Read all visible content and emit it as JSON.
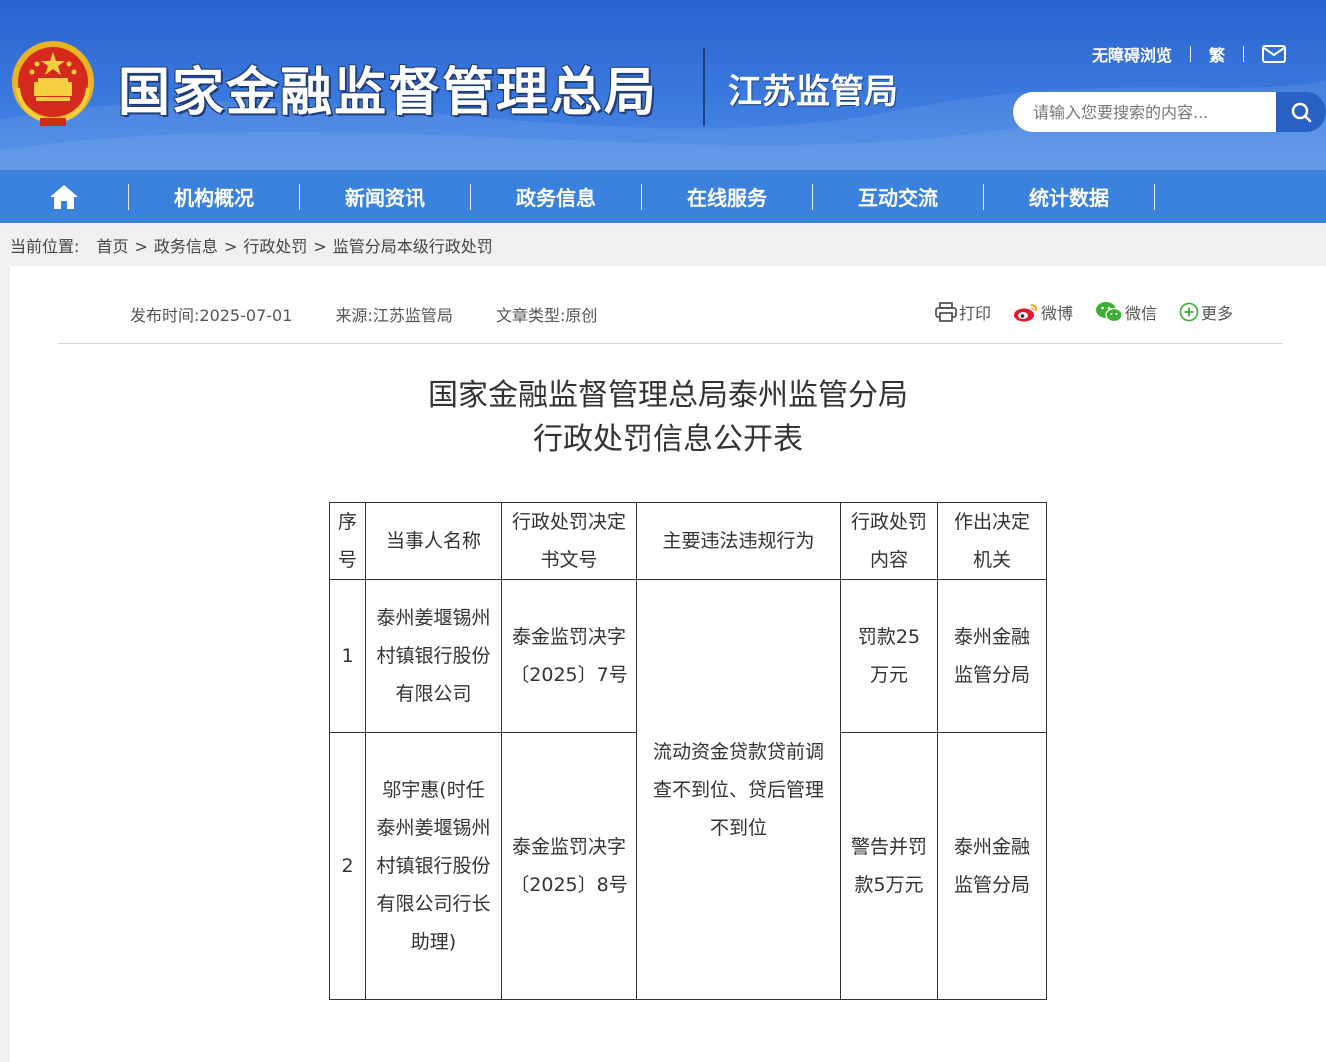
{
  "header": {
    "site_title": "国家金融监督管理总局",
    "sub_title": "江苏监管局",
    "accessibility_link": "无障碍浏览",
    "traditional_link": "繁",
    "search_placeholder": "请输入您要搜索的内容..."
  },
  "nav": {
    "items": [
      "机构概况",
      "新闻资讯",
      "政务信息",
      "在线服务",
      "互动交流",
      "统计数据"
    ]
  },
  "breadcrumb": {
    "prefix": "当前位置:",
    "items": [
      "首页",
      "政务信息",
      "行政处罚",
      "监管分局本级行政处罚"
    ]
  },
  "article": {
    "publish_time": "发布时间:2025-07-01",
    "source": "来源:江苏监管局",
    "type": "文章类型:原创",
    "share": {
      "print": "打印",
      "weibo": "微博",
      "wechat": "微信",
      "more": "更多"
    },
    "title_line1": "国家金融监督管理总局泰州监管分局",
    "title_line2": "行政处罚信息公开表"
  },
  "table": {
    "headers": [
      "序号",
      "当事人名称",
      "行政处罚决定书文号",
      "主要违法违规行为",
      "行政处罚内容",
      "作出决定机关"
    ],
    "rows": [
      {
        "no": "1",
        "party": "泰州姜堰锡州村镇银行股份有限公司",
        "doc_no": "泰金监罚决字〔2025〕7号",
        "penalty": "罚款25万元",
        "authority": "泰州金融监管分局"
      },
      {
        "no": "2",
        "party": "邬宇惠(时任泰州姜堰锡州村镇银行股份有限公司行长助理)",
        "doc_no": "泰金监罚决字〔2025〕8号",
        "penalty": "警告并罚款5万元",
        "authority": "泰州金融监管分局"
      }
    ],
    "violation": "流动资金贷款贷前调查不到位、贷后管理不到位"
  },
  "colors": {
    "header_blue": "#2a63cf",
    "nav_blue": "#3b82de",
    "search_btn": "#2a5fc4"
  }
}
